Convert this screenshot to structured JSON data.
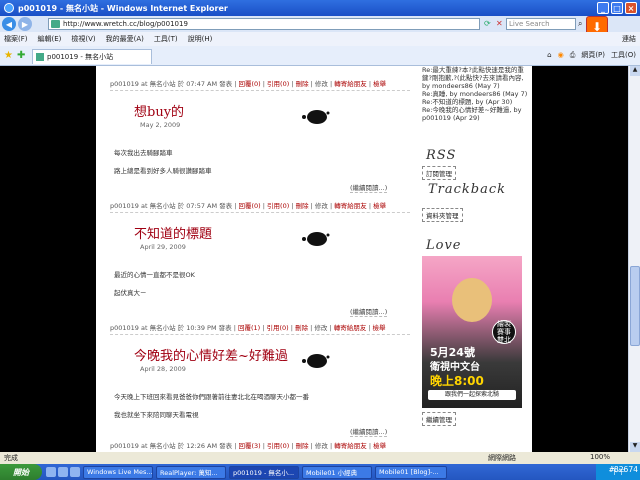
{
  "window": {
    "title": "p001019 - 無名小站 - Windows Internet Explorer"
  },
  "address": {
    "url": "http://www.wretch.cc/blog/p001019"
  },
  "search": {
    "placeholder": "Live Search"
  },
  "menu": [
    "檔案(F)",
    "編輯(E)",
    "檢視(V)",
    "我的最愛(A)",
    "工具(T)",
    "說明(H)"
  ],
  "menu_link": "連結",
  "tab": {
    "label": "p001019 - 無名小站"
  },
  "tools": [
    "網頁(P)",
    "工具(O)"
  ],
  "posts": [
    {
      "meta_prefix": "p001019 at 無名小站 於 07:47 AM 發表 |",
      "actions": [
        "回覆(0)",
        "引用(0)",
        "刪除",
        "修改",
        "轉寄給朋友",
        "檢舉"
      ],
      "title": "想buy的",
      "date": "May 2, 2009",
      "paragraphs": [
        "每次我出去騎腳踏車",
        "路上總是看到好多人騎很讚腳踏車"
      ],
      "more": "(繼續閱讀...)"
    },
    {
      "meta_prefix": "p001019 at 無名小站 於 07:57 AM 發表 |",
      "actions": [
        "回覆(0)",
        "引用(0)",
        "刪除",
        "修改",
        "轉寄給朋友",
        "檢舉"
      ],
      "title": "不知道的標題",
      "date": "April 29, 2009",
      "paragraphs": [
        "最近的心情一直都不是很OK",
        "起伏真大ㄧ"
      ],
      "more": "(繼續閱讀...)"
    },
    {
      "meta_prefix": "p001019 at 無名小站 於 10:39 PM 發表 |",
      "actions": [
        "回覆(1)",
        "引用(0)",
        "刪除",
        "修改",
        "轉寄給朋友",
        "檢舉"
      ],
      "title": "今晚我的心情好差~好難過",
      "date": "April 28, 2009",
      "paragraphs": [
        "今天晚上下班回來看見爸爸你們跟著前往妻北北在喝酒聊天小都一番",
        "我也就坐下來陪同聊天看電視"
      ],
      "more": "(繼續閱讀...)"
    },
    {
      "meta_prefix": "p001019 at 無名小站 於 12:26 AM 發表 |",
      "actions": [
        "回覆(3)",
        "引用(0)",
        "刪除",
        "修改",
        "轉寄給朋友",
        "檢舉"
      ]
    }
  ],
  "sidebar": {
    "recent_comments": [
      "Re:最大重練?本?此點快速是我的重鍵?剛抱歉,?(此點快?去來請看內容, by mondeers86 (May 7)",
      "Re:真睡, by mondeers86 (May 7)",
      "Re:不知道的標題, by (Apr 30)",
      "Re:今晚我的心情好差~好難過, by p001019 (Apr 29)"
    ],
    "rss_heading": "RSS",
    "rss_link": "訂閱管理",
    "trackback_heading": "Trackback",
    "trackback_link": "資料夾管理",
    "love_heading": "Love",
    "ad": {
      "seal": "繪製 賽事 雙北",
      "date": "5月24號",
      "channel": "衛視中文台",
      "time": "晚上8:00",
      "slogan": "跟我們一起探索北騎"
    },
    "love_link": "繼續管理"
  },
  "status": {
    "left": "完成",
    "zone": "網際網路",
    "zoom": "100%"
  },
  "taskbar": {
    "start": "開始",
    "tasks": [
      "Windows Live Mes...",
      "RealPlayer: 萬知...",
      "p001019 - 無名小...",
      "Mobile01 小經典",
      "Mobile01 [Blog]-..."
    ],
    "clock": "下午"
  },
  "watermark": "#82674"
}
